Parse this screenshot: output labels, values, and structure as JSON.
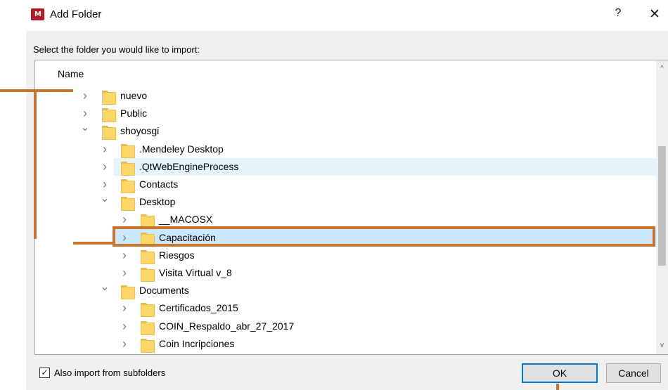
{
  "window": {
    "app_icon_text": "M",
    "title": "Add Folder",
    "help_label": "?",
    "close_label": "✕"
  },
  "prompt": "Select the folder you would like to import:",
  "tree": {
    "column_header": "Name",
    "rows": [
      {
        "label": "nuevo",
        "expanded": false,
        "depth": 0,
        "state": "normal"
      },
      {
        "label": "Public",
        "expanded": false,
        "depth": 0,
        "state": "normal"
      },
      {
        "label": "shoyosgi",
        "expanded": true,
        "depth": 0,
        "state": "normal"
      },
      {
        "label": ".Mendeley Desktop",
        "expanded": false,
        "depth": 1,
        "state": "normal"
      },
      {
        "label": ".QtWebEngineProcess",
        "expanded": false,
        "depth": 1,
        "state": "hover"
      },
      {
        "label": "Contacts",
        "expanded": false,
        "depth": 1,
        "state": "normal"
      },
      {
        "label": "Desktop",
        "expanded": true,
        "depth": 1,
        "state": "normal"
      },
      {
        "label": "__MACOSX",
        "expanded": false,
        "depth": 2,
        "state": "normal"
      },
      {
        "label": "Capacitación",
        "expanded": false,
        "depth": 2,
        "state": "selected"
      },
      {
        "label": "Riesgos",
        "expanded": false,
        "depth": 2,
        "state": "normal"
      },
      {
        "label": "Visita Virtual v_8",
        "expanded": false,
        "depth": 2,
        "state": "normal"
      },
      {
        "label": "Documents",
        "expanded": true,
        "depth": 1,
        "state": "normal"
      },
      {
        "label": "Certificados_2015",
        "expanded": false,
        "depth": 2,
        "state": "normal"
      },
      {
        "label": "COIN_Respaldo_abr_27_2017",
        "expanded": false,
        "depth": 2,
        "state": "normal"
      },
      {
        "label": "Coin Incripciones",
        "expanded": false,
        "depth": 2,
        "state": "normal"
      }
    ]
  },
  "scrollbar": {
    "up_glyph": "^",
    "down_glyph": "v"
  },
  "options": {
    "subfolders_label": "Also import from subfolders",
    "subfolders_checked": true,
    "check_glyph": "✓"
  },
  "buttons": {
    "ok": "OK",
    "cancel": "Cancel"
  },
  "colors": {
    "selection": "#cce8ff",
    "hover": "#e5f3fb",
    "folder": "#fcd768",
    "ok_border": "#0078d7",
    "annotation": "#c8752e"
  },
  "icons": {
    "collapsed": "chevron-right-icon",
    "expanded": "chevron-down-icon",
    "folder": "folder-icon",
    "checkbox": "checkbox-checked-icon"
  }
}
